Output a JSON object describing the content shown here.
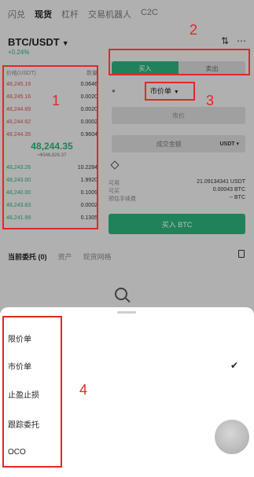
{
  "topnav": [
    "闪兑",
    "现货",
    "杠杆",
    "交易机器人",
    "C2C"
  ],
  "pair": {
    "symbol": "BTC/USDT",
    "change": "+0.24%"
  },
  "order_book": {
    "header_price": "价格(USDT)",
    "header_qty": "数量",
    "asks": [
      {
        "price": "48,245.19",
        "qty": "0.0646"
      },
      {
        "price": "48,245.16",
        "qty": "0.0020"
      },
      {
        "price": "48,244.89",
        "qty": "0.0020"
      },
      {
        "price": "48,244.62",
        "qty": "0.0002"
      },
      {
        "price": "48,244.35",
        "qty": "0.9604"
      }
    ],
    "mid_price": "48,244.35",
    "mid_sub": "≈¥346,826.37",
    "bids": [
      {
        "price": "48,243.26",
        "qty": "10.2284"
      },
      {
        "price": "48,243.00",
        "qty": "1.9920"
      },
      {
        "price": "48,240.00",
        "qty": "0.1009"
      },
      {
        "price": "48,243.83",
        "qty": "0.0002"
      },
      {
        "price": "48,241.99",
        "qty": "0.1305"
      }
    ]
  },
  "form": {
    "buy_tab": "买入",
    "sell_tab": "卖出",
    "order_type": "市价单",
    "price_placeholder": "市价",
    "amount_label": "成交金额",
    "amount_unit": "USDT",
    "available_label": "可用",
    "available_value": "21.09134341 USDT",
    "can_buy_label": "可买",
    "can_buy_value": "0.00043 BTC",
    "fee_label": "预估手续费",
    "fee_value": "-- BTC",
    "buy_button": "买入 BTC"
  },
  "orders_tabs": [
    "当前委托 (0)",
    "资产",
    "现货网格"
  ],
  "sheet": {
    "options": [
      "限价单",
      "市价单",
      "止盈止损",
      "跟踪委托",
      "OCO"
    ],
    "selected": "市价单"
  },
  "annotations": [
    "1",
    "2",
    "3",
    "4"
  ],
  "colors": {
    "buy_green": "#2bb07a",
    "ask_red": "#d9534f",
    "annotation_red": "#e32727"
  }
}
